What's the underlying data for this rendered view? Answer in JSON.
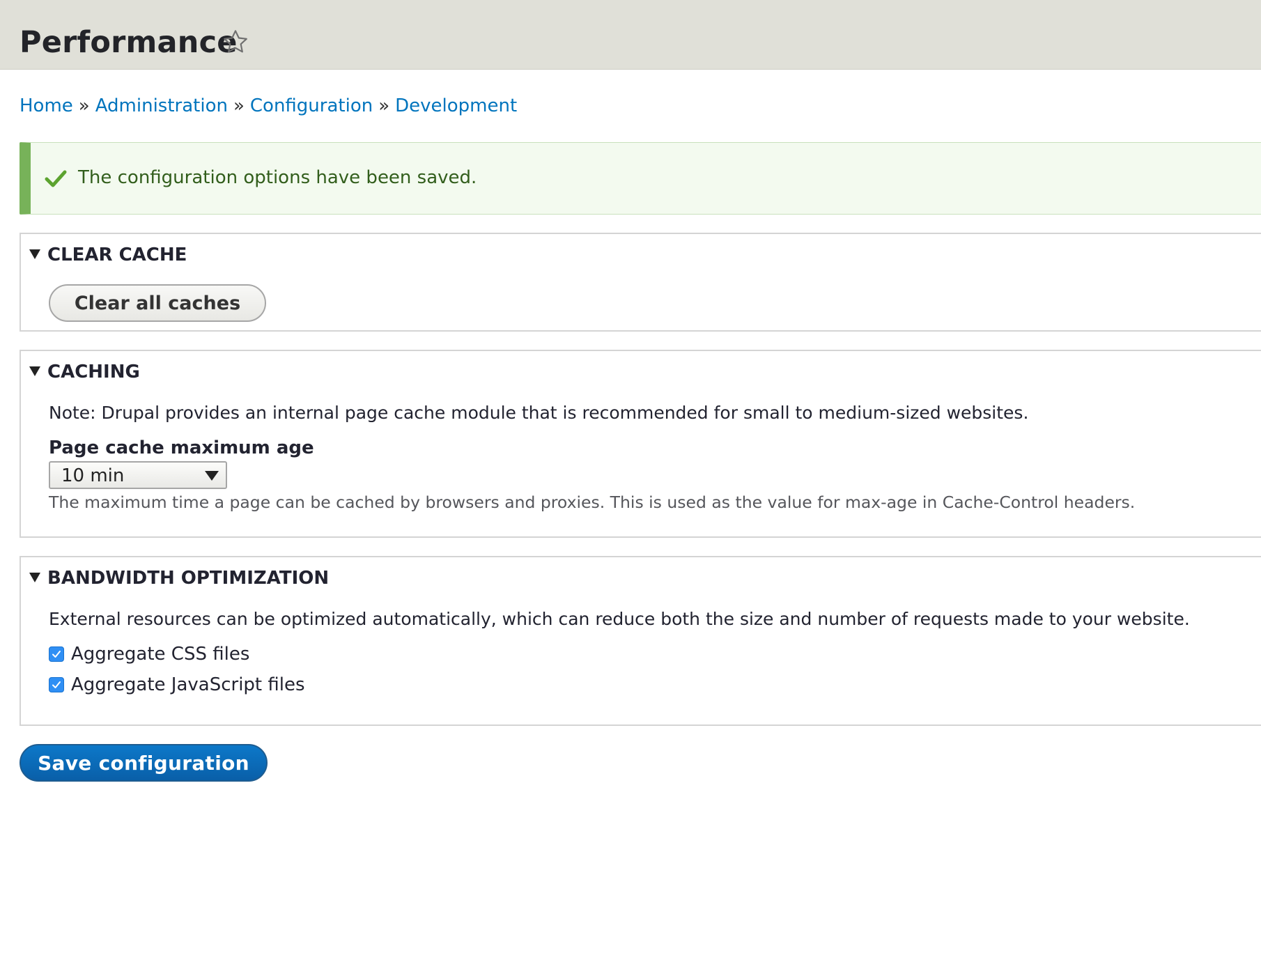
{
  "header": {
    "title": "Performance",
    "shortcut_icon": "star-outline-icon"
  },
  "breadcrumb": {
    "items": [
      "Home",
      "Administration",
      "Configuration",
      "Development"
    ],
    "separator": "»"
  },
  "message": {
    "type": "status",
    "icon": "checkmark-icon",
    "text": "The configuration options have been saved.",
    "accent_color": "#77b259"
  },
  "sections": {
    "clear_cache": {
      "title": "CLEAR CACHE",
      "expanded": true,
      "button_label": "Clear all caches"
    },
    "caching": {
      "title": "CACHING",
      "expanded": true,
      "note": "Note: Drupal provides an internal page cache module that is recommended for small to medium-sized websites.",
      "field_label": "Page cache maximum age",
      "select_value": "10 min",
      "help": "The maximum time a page can be cached by browsers and proxies. This is used as the value for max-age in Cache-Control headers."
    },
    "bandwidth": {
      "title": "BANDWIDTH OPTIMIZATION",
      "expanded": true,
      "description": "External resources can be optimized automatically, which can reduce both the size and number of requests made to your website.",
      "checkboxes": [
        {
          "label": "Aggregate CSS files",
          "checked": true
        },
        {
          "label": "Aggregate JavaScript files",
          "checked": true
        }
      ]
    }
  },
  "actions": {
    "save_label": "Save configuration",
    "primary_color": "#0074bd"
  }
}
